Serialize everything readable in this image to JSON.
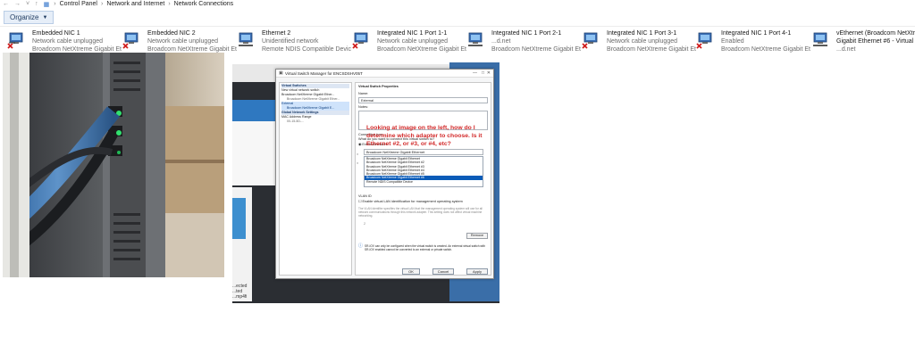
{
  "address_bar": {
    "crumbs": [
      "Control Panel",
      "Network and Internet",
      "Network Connections"
    ]
  },
  "toolbar": {
    "organize_label": "Organize"
  },
  "adapters": [
    {
      "name": "Embedded NIC 1",
      "status": "Network cable unplugged",
      "device": "Broadcom NetXtreme Gigabit Eth...",
      "error": true
    },
    {
      "name": "Embedded NIC 2",
      "status": "Network cable unplugged",
      "device": "Broadcom NetXtreme Gigabit Eth...",
      "error": true
    },
    {
      "name": "Ethernet 2",
      "status": "Unidentified network",
      "device": "Remote NDIS Compatible Device",
      "error": false
    },
    {
      "name": "Integrated NIC 1 Port 1-1",
      "status": "Network cable unplugged",
      "device": "Broadcom NetXtreme Gigabit Eth...",
      "error": true
    },
    {
      "name": "Integrated NIC 1 Port 2-1",
      "status": "...d.net",
      "device": "Broadcom NetXtreme Gigabit Eth...",
      "error": false
    },
    {
      "name": "Integrated NIC 1 Port 3-1",
      "status": "Network cable unplugged",
      "device": "Broadcom NetXtreme Gigabit Eth...",
      "error": true
    },
    {
      "name": "Integrated NIC 1 Port 4-1",
      "status": "Enabled",
      "device": "Broadcom NetXtreme Gigabit Eth...",
      "error": true
    },
    {
      "name": "vEthernet (Broadcom NetXtreme",
      "status": "Gigabit Ethernet #6 - Virtual Swi",
      "device": "...d.net",
      "error": false
    }
  ],
  "vsm": {
    "title": "Virtual Switch Manager for ENCSDSHV05T",
    "tree": {
      "header_switches": "Virtual Switches",
      "new_switch": "New virtual network switch",
      "switch1": "Broadcom NetXtreme Gigabit Ether...",
      "switch1_sub": "Broadcom NetXtreme Gigabit Ether...",
      "external": "External",
      "external_sub": "Broadcom NetXtreme Gigabit E...",
      "header_global": "Global Network Settings",
      "mac_range": "MAC Address Range",
      "mac_sub": "00-15-5D-..."
    },
    "props": {
      "heading": "Virtual Switch Properties",
      "name_label": "Name:",
      "name_value": "External",
      "notes_label": "Notes:",
      "conn_type_label": "Connection type",
      "conn_question": "What do you want to connect this virtual switch to?",
      "external_network": "External network:",
      "selected_adapter": "Broadcom NetXtreme Gigabit Ethernet",
      "adapter_options": [
        "Broadcom NetXtreme Gigabit Ethernet",
        "Broadcom NetXtreme Gigabit Ethernet #2",
        "Broadcom NetXtreme Gigabit Ethernet #3",
        "Broadcom NetXtreme Gigabit Ethernet #4",
        "Broadcom NetXtreme Gigabit Ethernet #5",
        "Broadcom NetXtreme Gigabit Ethernet #6",
        "Remote NDIS Compatible Device"
      ],
      "selected_index": 5,
      "vlan_label": "VLAN ID",
      "vlan_checkbox": "Enable virtual LAN identification for management operating system",
      "vlan_help": "The VLAN identifier specifies the virtual LAN that the management operating system will use for all network communications through this network adapter. This setting does not affect virtual machine networking.",
      "vlan_value": "2",
      "remove_button": "Remove",
      "sriov_note": "SR-IOV can only be configured when the virtual switch is created. An external virtual switch with SR-IOV enabled cannot be converted to an external or private switch."
    },
    "buttons": {
      "ok": "OK",
      "cancel": "Cancel",
      "apply": "Apply"
    }
  },
  "annotation": "Looking at image on the left, how do I determine which adapter to choose. Is it Ethernet #2, or #3, or #4, etc?",
  "fragments": {
    "f1": "...ected",
    "f2": "...ted",
    "f3": "...mp4fi"
  },
  "colors": {
    "annotation": "#d22a2a",
    "selection": "#0a5bb8",
    "error_x": "#d11f1f"
  }
}
